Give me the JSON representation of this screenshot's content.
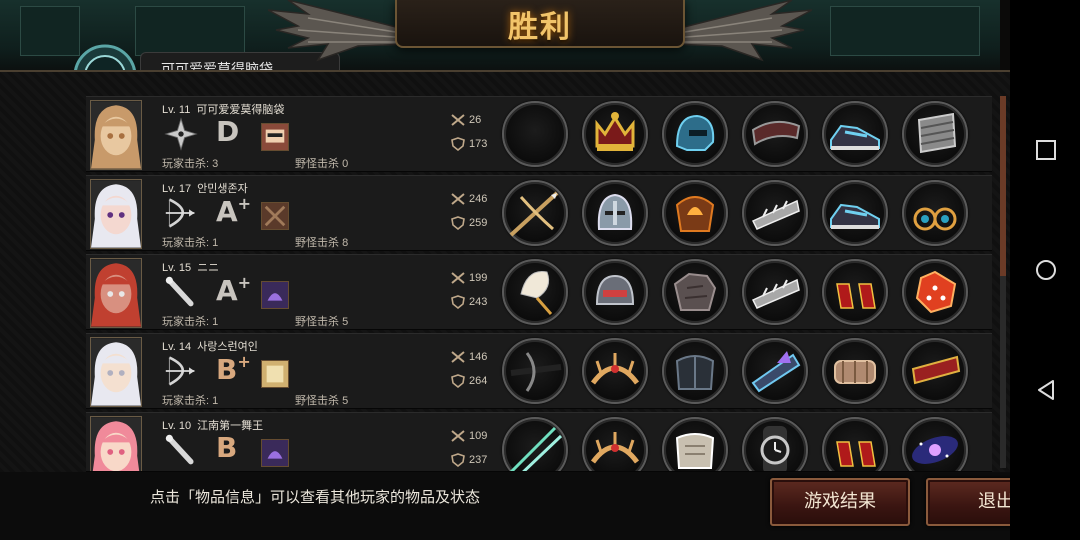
{
  "title": "胜利",
  "notice_text": "可可爱爱莫得脑袋",
  "hint": "点击「物品信息」可以查看其他玩家的物品及状态",
  "buttons": {
    "results": "游戏结果",
    "exit": "退出"
  },
  "kill_labels": {
    "players": "玩家击杀",
    "monsters": "野怪击杀"
  },
  "players": [
    {
      "level": "Lv. 11",
      "name": "可可爱爱莫得脑袋",
      "weapon_icon": "shuriken-icon",
      "grade": "D",
      "player_kills": "3",
      "monster_kills": "0",
      "attack": "26",
      "defense": "173",
      "items": [
        "empty-slot",
        "crown-icon",
        "helmet-icon",
        "bracer-icon",
        "sneaker-icon",
        "leg-armor-icon"
      ]
    },
    {
      "level": "Lv. 17",
      "name": "안민생존자",
      "weapon_icon": "bow-icon",
      "grade": "A+",
      "player_kills": "1",
      "monster_kills": "8",
      "attack": "246",
      "defense": "259",
      "items": [
        "crossbow-icon",
        "knight-helmet-icon",
        "flame-armor-icon",
        "spiked-gauntlet-icon",
        "sneaker-icon",
        "earrings-icon"
      ]
    },
    {
      "level": "Lv. 15",
      "name": "ニニ",
      "weapon_icon": "bat-icon",
      "grade": "A+",
      "player_kills": "1",
      "monster_kills": "5",
      "attack": "199",
      "defense": "243",
      "items": [
        "feather-quill-icon",
        "robot-helmet-icon",
        "rock-armor-icon",
        "spiked-gauntlet-icon",
        "red-heels-icon",
        "dice-icon"
      ]
    },
    {
      "level": "Lv. 14",
      "name": "사랑스런여인",
      "weapon_icon": "bow-icon",
      "grade": "B+",
      "player_kills": "1",
      "monster_kills": "5",
      "attack": "146",
      "defense": "264",
      "items": [
        "black-crossbow-icon",
        "tiara-icon",
        "dark-armor-icon",
        "crystal-gauntlet-icon",
        "bandage-icon",
        "red-bracer-icon"
      ]
    },
    {
      "level": "Lv. 10",
      "name": "江南第一舞王",
      "weapon_icon": "bat-icon",
      "grade": "B",
      "player_kills": "",
      "monster_kills": "",
      "attack": "109",
      "defense": "237",
      "items": [
        "twin-blades-icon",
        "tiara-icon",
        "plate-armor-icon",
        "watch-icon",
        "red-heels-icon",
        "galaxy-icon"
      ]
    }
  ],
  "colors": {
    "title": "#f2c46a",
    "button": "#3a1511",
    "accent": "#6b3b27"
  }
}
